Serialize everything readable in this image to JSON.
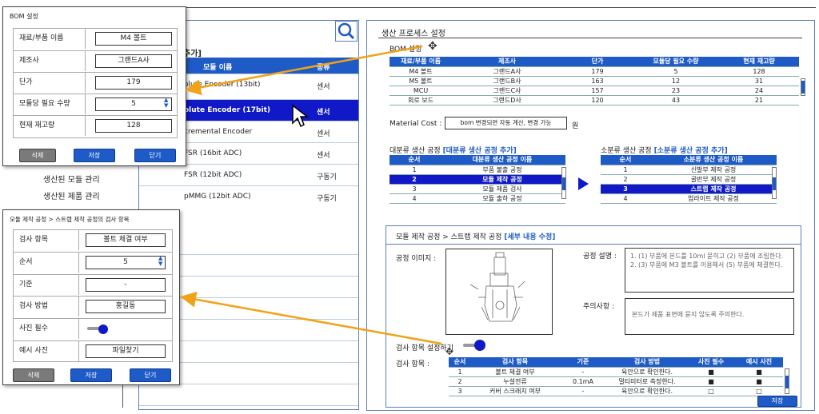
{
  "module_list": {
    "header_suffix": "추가]",
    "col_name": "모듈 이름",
    "col_type": "종류",
    "rows": [
      {
        "name": "olute Encoder (13bit)",
        "type": "센서"
      },
      {
        "name": "olute Encoder (17bit)",
        "type": "센서"
      },
      {
        "name": "cremental Encoder",
        "type": "센서"
      },
      {
        "name": "FSR (16bit ADC)",
        "type": "센서"
      },
      {
        "name": "FSR (12bit ADC)",
        "type": "구동기"
      },
      {
        "name": "pMMG (12bit ADC)",
        "type": "구동기"
      }
    ]
  },
  "side_menu": [
    "생산된 모듈 관리",
    "생산된 제품 관리"
  ],
  "bom_dialog": {
    "title": "BOM 설정",
    "fields": [
      {
        "label": "재료/부품 이름",
        "value": "M4 볼트"
      },
      {
        "label": "제조사",
        "value": "그랜드A사"
      },
      {
        "label": "단가",
        "value": "179"
      },
      {
        "label": "모듈당 필요 수량",
        "value": "5"
      },
      {
        "label": "현재 재고량",
        "value": "128"
      }
    ],
    "buttons": [
      "삭제",
      "저장",
      "닫기"
    ]
  },
  "insp_dialog": {
    "title": "모듈 제작 공정 > 스트랩 제작 공정의 검사 항목",
    "fields": [
      {
        "label": "검사 항목",
        "value": "볼트 체결 여부"
      },
      {
        "label": "순서",
        "value": "5"
      },
      {
        "label": "기준",
        "value": "-"
      },
      {
        "label": "검사 방법",
        "value": "홍길동"
      },
      {
        "label": "사진 필수",
        "value": ""
      },
      {
        "label": "예시 사진",
        "value": "파일찾기"
      }
    ],
    "buttons": [
      "삭제",
      "저장",
      "닫기"
    ]
  },
  "process_panel": {
    "title": "생산 프로세스 설정",
    "bom_label": "BOM 설정",
    "bom_table": {
      "headers": [
        "재료/부품 이름",
        "제조사",
        "단가",
        "모듈당 필요 수량",
        "현재 재고량"
      ],
      "rows": [
        [
          "M4 볼트",
          "그랜드A사",
          "179",
          "5",
          "128"
        ],
        [
          "M5 볼트",
          "그랜드B사",
          "163",
          "12",
          "31"
        ],
        [
          "MCU",
          "그랜드C사",
          "157",
          "23",
          "24"
        ],
        [
          "회로 보드",
          "그랜드D사",
          "120",
          "43",
          "21"
        ]
      ]
    },
    "material_cost_label": "Material Cost :",
    "material_cost_value": "bom 변경되면 자동 계산, 변경 가능",
    "material_cost_unit": "원",
    "major_label": "대분류 생산 공정",
    "major_add": "[대분류 생산 공정 추가]",
    "major_table": {
      "headers": [
        "순서",
        "대분류 생산 공정 이름"
      ],
      "rows": [
        [
          "1",
          "부품 불출 공정"
        ],
        [
          "2",
          "모듈 제작 공정"
        ],
        [
          "3",
          "모듈 제품 검사"
        ],
        [
          "4",
          "모듈 출하 공정"
        ]
      ]
    },
    "minor_label": "소분류 생산 공정",
    "minor_add": "[소분류 생산 공정 추가]",
    "minor_table": {
      "headers": [
        "순서",
        "소분류 생산 공정 이름"
      ],
      "rows": [
        [
          "1",
          "신발부 제작 공정"
        ],
        [
          "2",
          "골반부 제작 공정"
        ],
        [
          "3",
          "스트랩 제작 공정"
        ],
        [
          "4",
          "업라이트 제작 공정"
        ]
      ]
    },
    "detail_title": "모듈 제작 공정 > 스트랩 제작 공정",
    "detail_edit": "[세부 내용 수정]",
    "image_label": "공정 이미지 :",
    "desc_label": "공정 설명 :",
    "desc_text": "1. (1) 부품에 본드를 10ml 묻히고 (2) 부품에 조립한다.\n2. (3) 부품에 M3 볼트를 이용해서 (5) 부품에 체결한다.",
    "caution_label": "주의사항 :",
    "caution_text": "본드가 제품 표면에 묻지 않도록 주의한다.",
    "insp_setting_label": "검사 항목 설정하기",
    "insp_label": "검사 항목 :",
    "insp_table": {
      "headers": [
        "순서",
        "검사 항목",
        "기준",
        "검사 방법",
        "사진 필수",
        "예시 사진"
      ],
      "rows": [
        [
          "1",
          "볼트 체결 여부",
          "-",
          "육안으로 확인한다.",
          "■",
          "■"
        ],
        [
          "2",
          "누설전류",
          "0.1mA",
          "멀티미터로 측정한다.",
          "■",
          "■"
        ],
        [
          "3",
          "커버 스크래치 여부",
          "-",
          "육안으로 확인한다.",
          "□",
          "□"
        ]
      ]
    },
    "save_label": "저장"
  },
  "colors": {
    "accent": "#1e5bc6",
    "selected": "#1018c8",
    "arrow": "#f0a318"
  }
}
